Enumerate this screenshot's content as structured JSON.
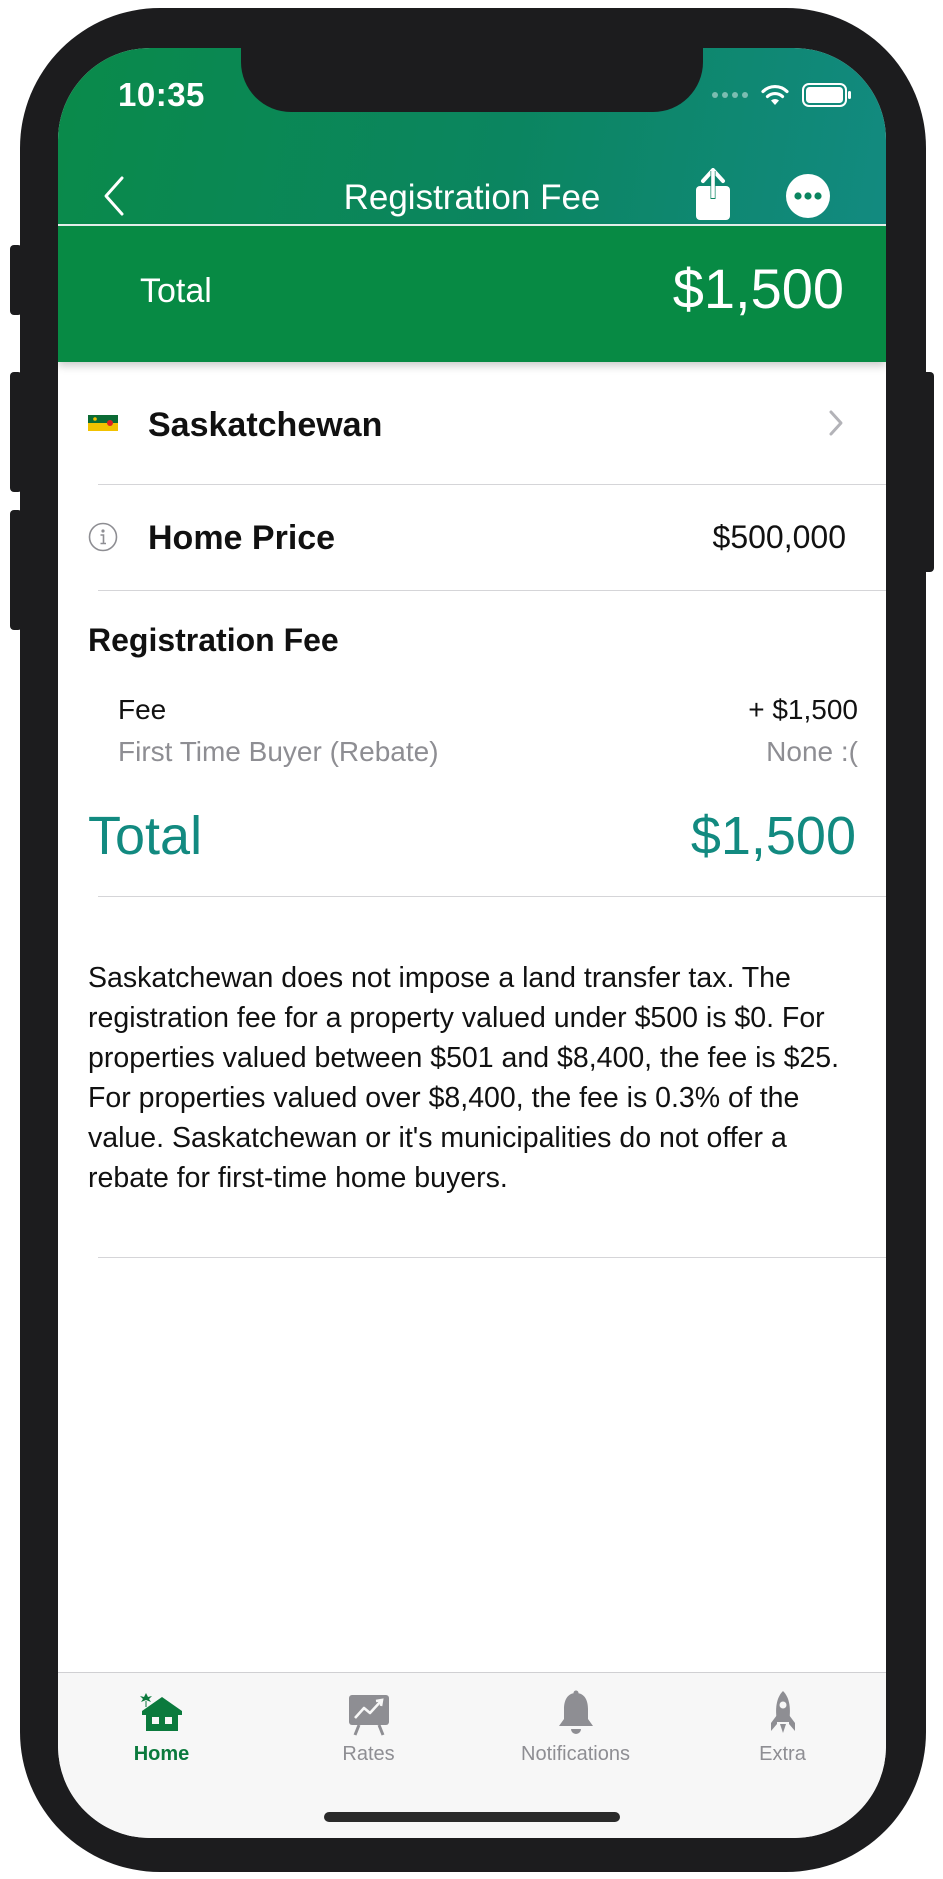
{
  "status_bar": {
    "time": "10:35"
  },
  "nav": {
    "title": "Registration Fee"
  },
  "total_banner": {
    "label": "Total",
    "value": "$1,500"
  },
  "province": {
    "name": "Saskatchewan",
    "flag_colors": [
      "#0b6b35",
      "#f2c200"
    ]
  },
  "home_price": {
    "label": "Home Price",
    "value": "$500,000"
  },
  "fee_section": {
    "title": "Registration Fee",
    "rows": [
      {
        "label": "Fee",
        "value": "+ $1,500",
        "muted": false
      },
      {
        "label": "First Time Buyer (Rebate)",
        "value": "None :(",
        "muted": true
      }
    ],
    "total_label": "Total",
    "total_value": "$1,500"
  },
  "description": "Saskatchewan does not impose a land transfer tax. The registration fee for a property valued under $500 is $0. For properties valued between $501 and $8,400, the fee is $25. For properties valued over $8,400, the fee is 0.3% of the value. Saskatchewan or it's municipalities do not offer a rebate for first-time home buyers.",
  "tabs": [
    {
      "label": "Home",
      "icon": "home-icon",
      "active": true
    },
    {
      "label": "Rates",
      "icon": "chart-board-icon",
      "active": false
    },
    {
      "label": "Notifications",
      "icon": "bell-icon",
      "active": false
    },
    {
      "label": "Extra",
      "icon": "rocket-icon",
      "active": false
    }
  ],
  "colors": {
    "header_green": "#0a8a4a",
    "banner_green": "#078a44",
    "teal_total": "#128a80",
    "tab_active": "#0b7a3d",
    "tab_inactive": "#8e8e93"
  }
}
